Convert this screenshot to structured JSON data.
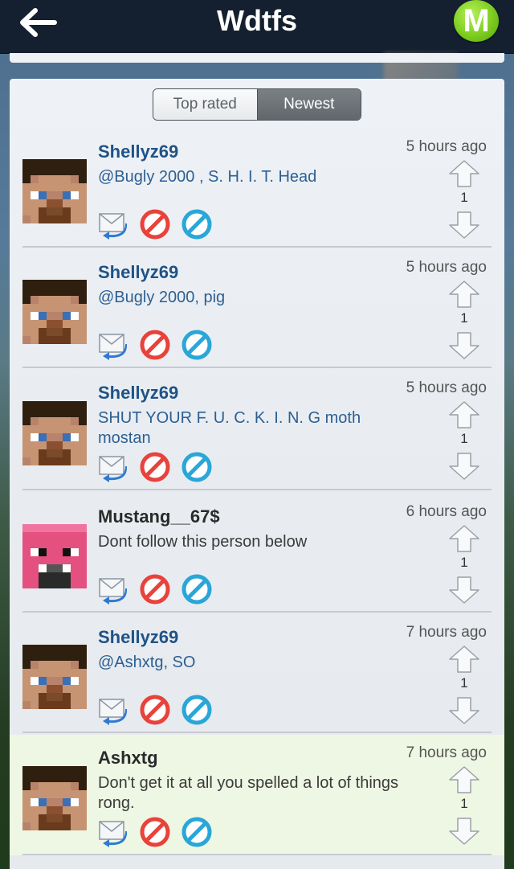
{
  "header": {
    "title": "Wdtfs",
    "logo_letter": "M"
  },
  "tabs": {
    "top_rated": "Top rated",
    "newest": "Newest",
    "selected": "Newest"
  },
  "colors": {
    "navbar": "#142030",
    "username_blue": "#1f5287",
    "highlight": "#eef7e3",
    "logo_green": "#7ccc1e",
    "block_red": "#e8423a",
    "report_blue": "#2aa6d8"
  },
  "comments": [
    {
      "username": "Shellyz69",
      "text": "@Bugly 2000 , S. H. I. T. Head",
      "time": "5 hours ago",
      "votes": "1",
      "avatar": "steve-avatar"
    },
    {
      "username": "Shellyz69",
      "text": "@Bugly 2000, pig",
      "time": "5 hours ago",
      "votes": "1",
      "avatar": "steve-avatar"
    },
    {
      "username": "Shellyz69",
      "text": "SHUT YOUR F. U. C. K. I. N. G moth mostan",
      "time": "5 hours ago",
      "votes": "1",
      "avatar": "steve-avatar"
    },
    {
      "username": "Mustang__67$",
      "text": "Dont follow this person below",
      "time": "6 hours ago",
      "votes": "1",
      "avatar": "pig-avatar"
    },
    {
      "username": "Shellyz69",
      "text": "@Ashxtg, SO",
      "time": "7 hours ago",
      "votes": "1",
      "avatar": "steve-avatar"
    },
    {
      "username": "Ashxtg",
      "text": "Don't get it at all you spelled a lot of things rong.",
      "time": "7 hours ago",
      "votes": "1",
      "avatar": "steve-avatar"
    }
  ],
  "icons": {
    "back": "back-arrow-icon",
    "reply": "reply-envelope-icon",
    "block": "block-icon",
    "report": "report-icon",
    "up": "vote-up-arrow-icon",
    "down": "vote-down-arrow-icon"
  }
}
